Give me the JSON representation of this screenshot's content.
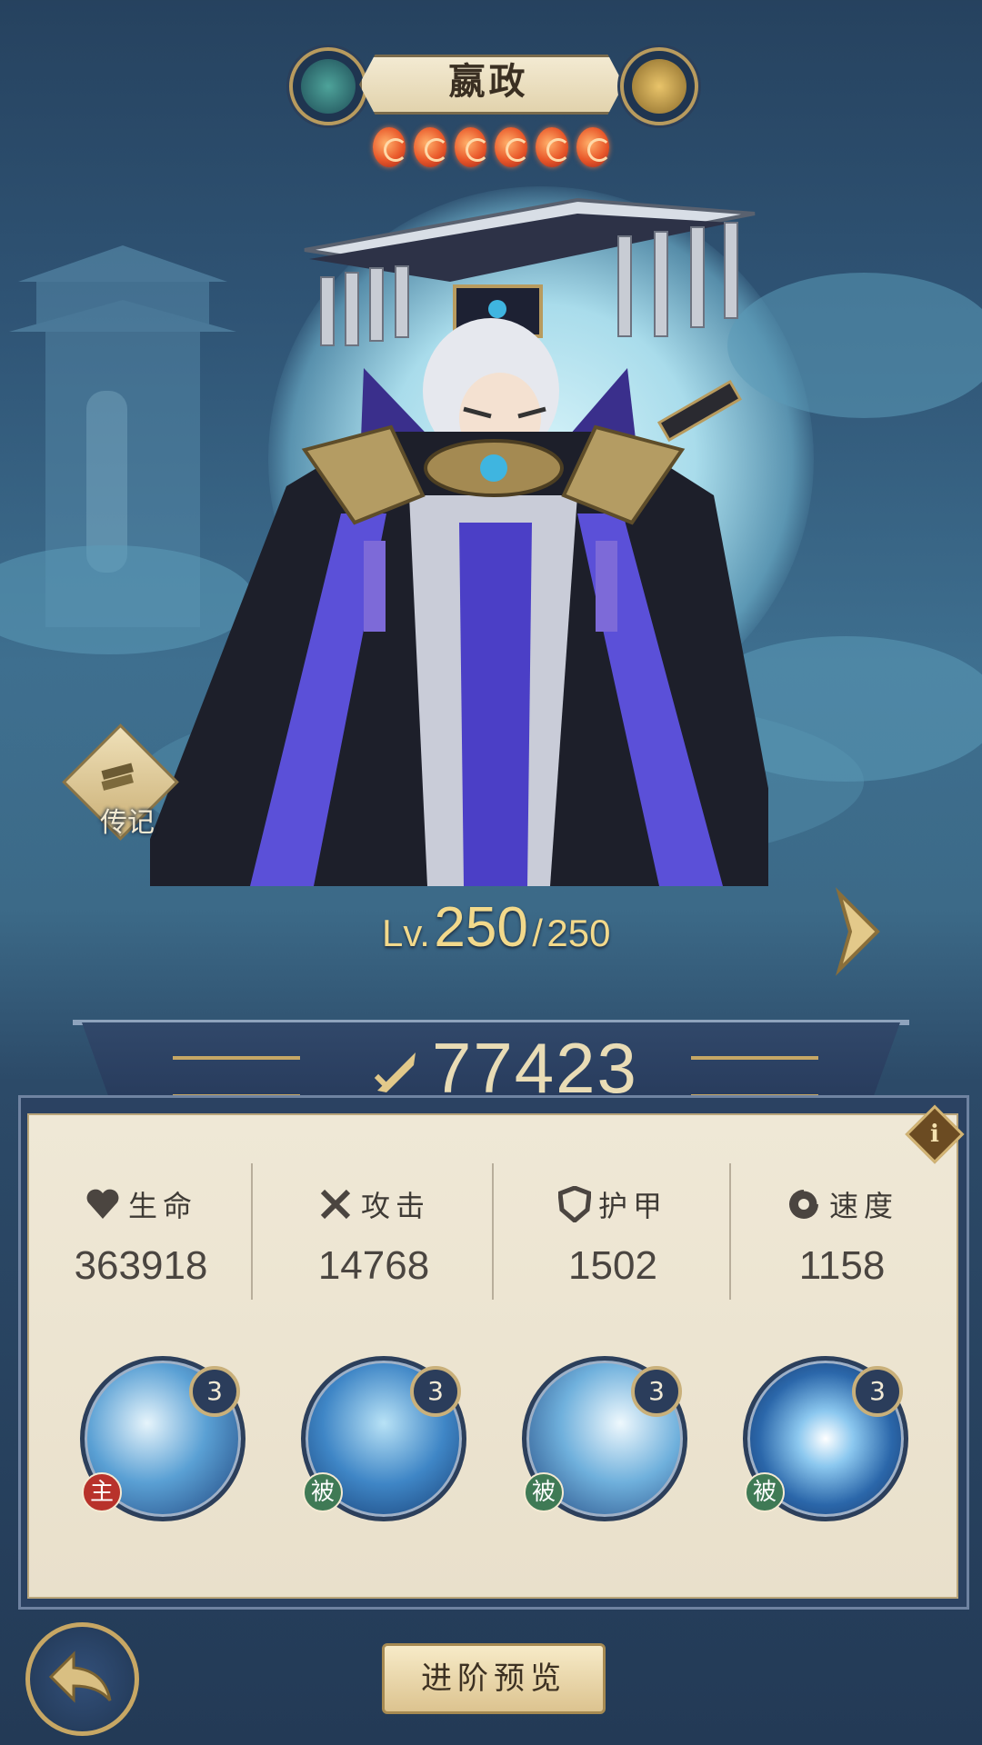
{
  "hero": {
    "name": "嬴政",
    "stars": 6,
    "level_prefix": "Lv.",
    "level_current": "250",
    "level_separator": "/",
    "level_max": "250"
  },
  "biography": {
    "label": "传记"
  },
  "power": {
    "value": "77423",
    "icon": "power-sword-icon"
  },
  "stats": [
    {
      "label": "生命",
      "value": "363918",
      "icon": "heart-icon"
    },
    {
      "label": "攻击",
      "value": "14768",
      "icon": "crossed-swords-icon"
    },
    {
      "label": "护甲",
      "value": "1502",
      "icon": "shield-icon"
    },
    {
      "label": "速度",
      "value": "1158",
      "icon": "swirl-icon"
    }
  ],
  "skills": [
    {
      "level": "3",
      "tag": "主",
      "tag_color": "#b8322b"
    },
    {
      "level": "3",
      "tag": "被",
      "tag_color": "#3f7a55"
    },
    {
      "level": "3",
      "tag": "被",
      "tag_color": "#3f7a55"
    },
    {
      "level": "3",
      "tag": "被",
      "tag_color": "#3f7a55"
    }
  ],
  "buttons": {
    "preview": "进阶预览"
  },
  "colors": {
    "accent_gold": "#c7a764",
    "panel": "#efe8d6",
    "navy": "#2b4262"
  }
}
